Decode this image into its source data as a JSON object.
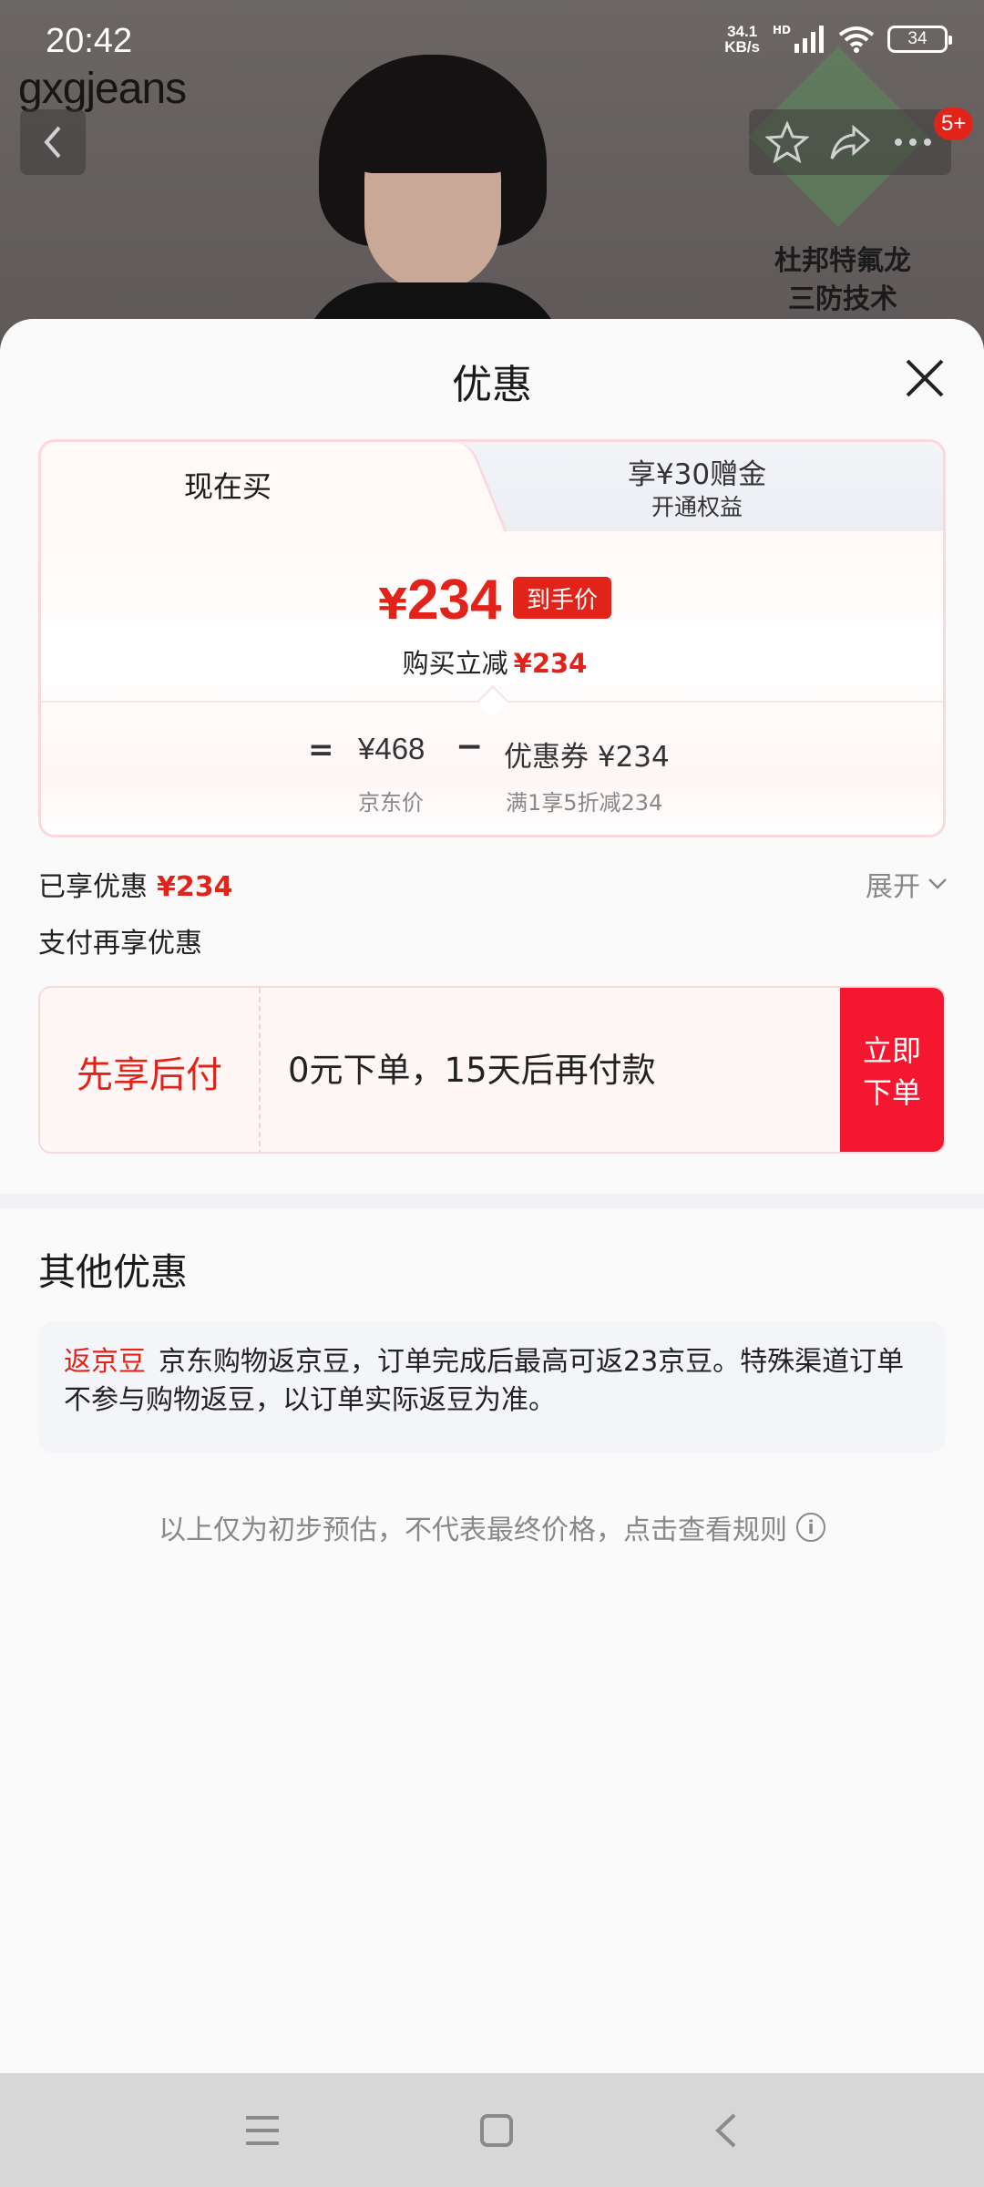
{
  "status_bar": {
    "time": "20:42",
    "net_speed_value": "34.1",
    "net_speed_unit": "KB/s",
    "hd": "HD",
    "battery": "34"
  },
  "background": {
    "brand": "gxgjeans",
    "cart_badge": "5+",
    "feature_line1": "杜邦特氟龙",
    "feature_line2": "三防技术"
  },
  "sheet": {
    "title": "优惠"
  },
  "tabs": {
    "buy_now": "现在买",
    "gift_title": "享¥30赠金",
    "gift_subtitle": "开通权益"
  },
  "price_card": {
    "currency": "¥",
    "final_price": "234",
    "final_tag": "到手价",
    "reduce_label": "购买立减",
    "reduce_amount": "¥234",
    "eq": "=",
    "jd_price": "¥468",
    "minus": "−",
    "coupon": "优惠券 ¥234",
    "jd_price_label": "京东价",
    "coupon_rule": "满1享5折减234"
  },
  "enjoyed": {
    "label": "已享优惠",
    "amount": "¥234",
    "expand": "展开",
    "pay_more": "支付再享优惠"
  },
  "pay_later": {
    "title": "先享后付",
    "desc": "0元下单，15天后再付款",
    "btn_line1": "立即",
    "btn_line2": "下单"
  },
  "other": {
    "title": "其他优惠",
    "bean_tag": "返京豆",
    "bean_text": "京东购物返京豆，订单完成后最高可返23京豆。特殊渠道订单不参与购物返豆，以订单实际返豆为准。"
  },
  "disclaimer": "以上仅为初步预估，不代表最终价格，点击查看规则",
  "colors": {
    "accent": "#e2231a",
    "button_red": "#f5162f"
  }
}
